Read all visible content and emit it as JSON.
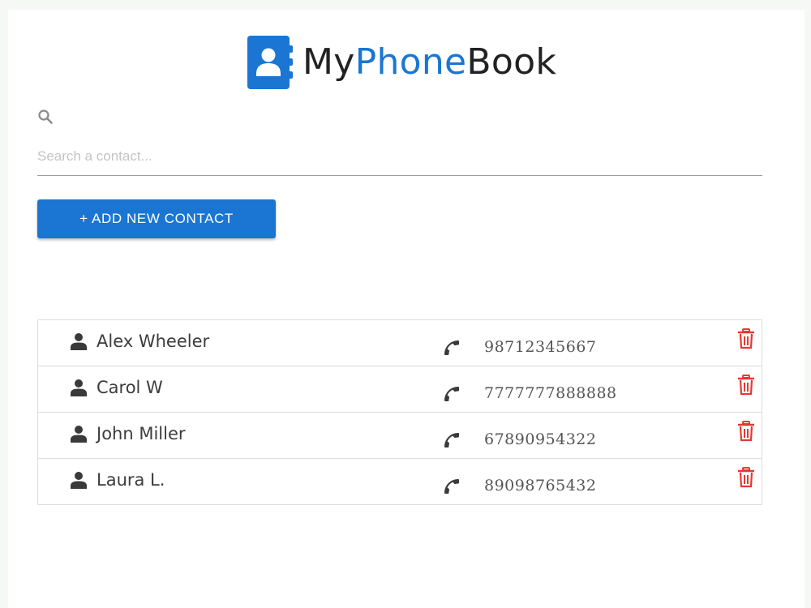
{
  "app": {
    "logo_prefix": "My",
    "logo_accent": "Phone",
    "logo_suffix": "Book",
    "accent_color": "#1a76d2"
  },
  "search": {
    "icon": "search-icon",
    "placeholder": "Search a contact...",
    "value": ""
  },
  "actions": {
    "add_label": "+ ADD NEW CONTACT"
  },
  "contacts": [
    {
      "name": "Alex Wheeler",
      "phone": "98712345667"
    },
    {
      "name": "Carol W",
      "phone": "7777777888888"
    },
    {
      "name": "John Miller",
      "phone": "67890954322"
    },
    {
      "name": "Laura L.",
      "phone": "89098765432"
    }
  ],
  "icons": {
    "person": "person-icon",
    "phone": "phone-icon",
    "delete": "trash-icon",
    "delete_color": "#e53935"
  }
}
